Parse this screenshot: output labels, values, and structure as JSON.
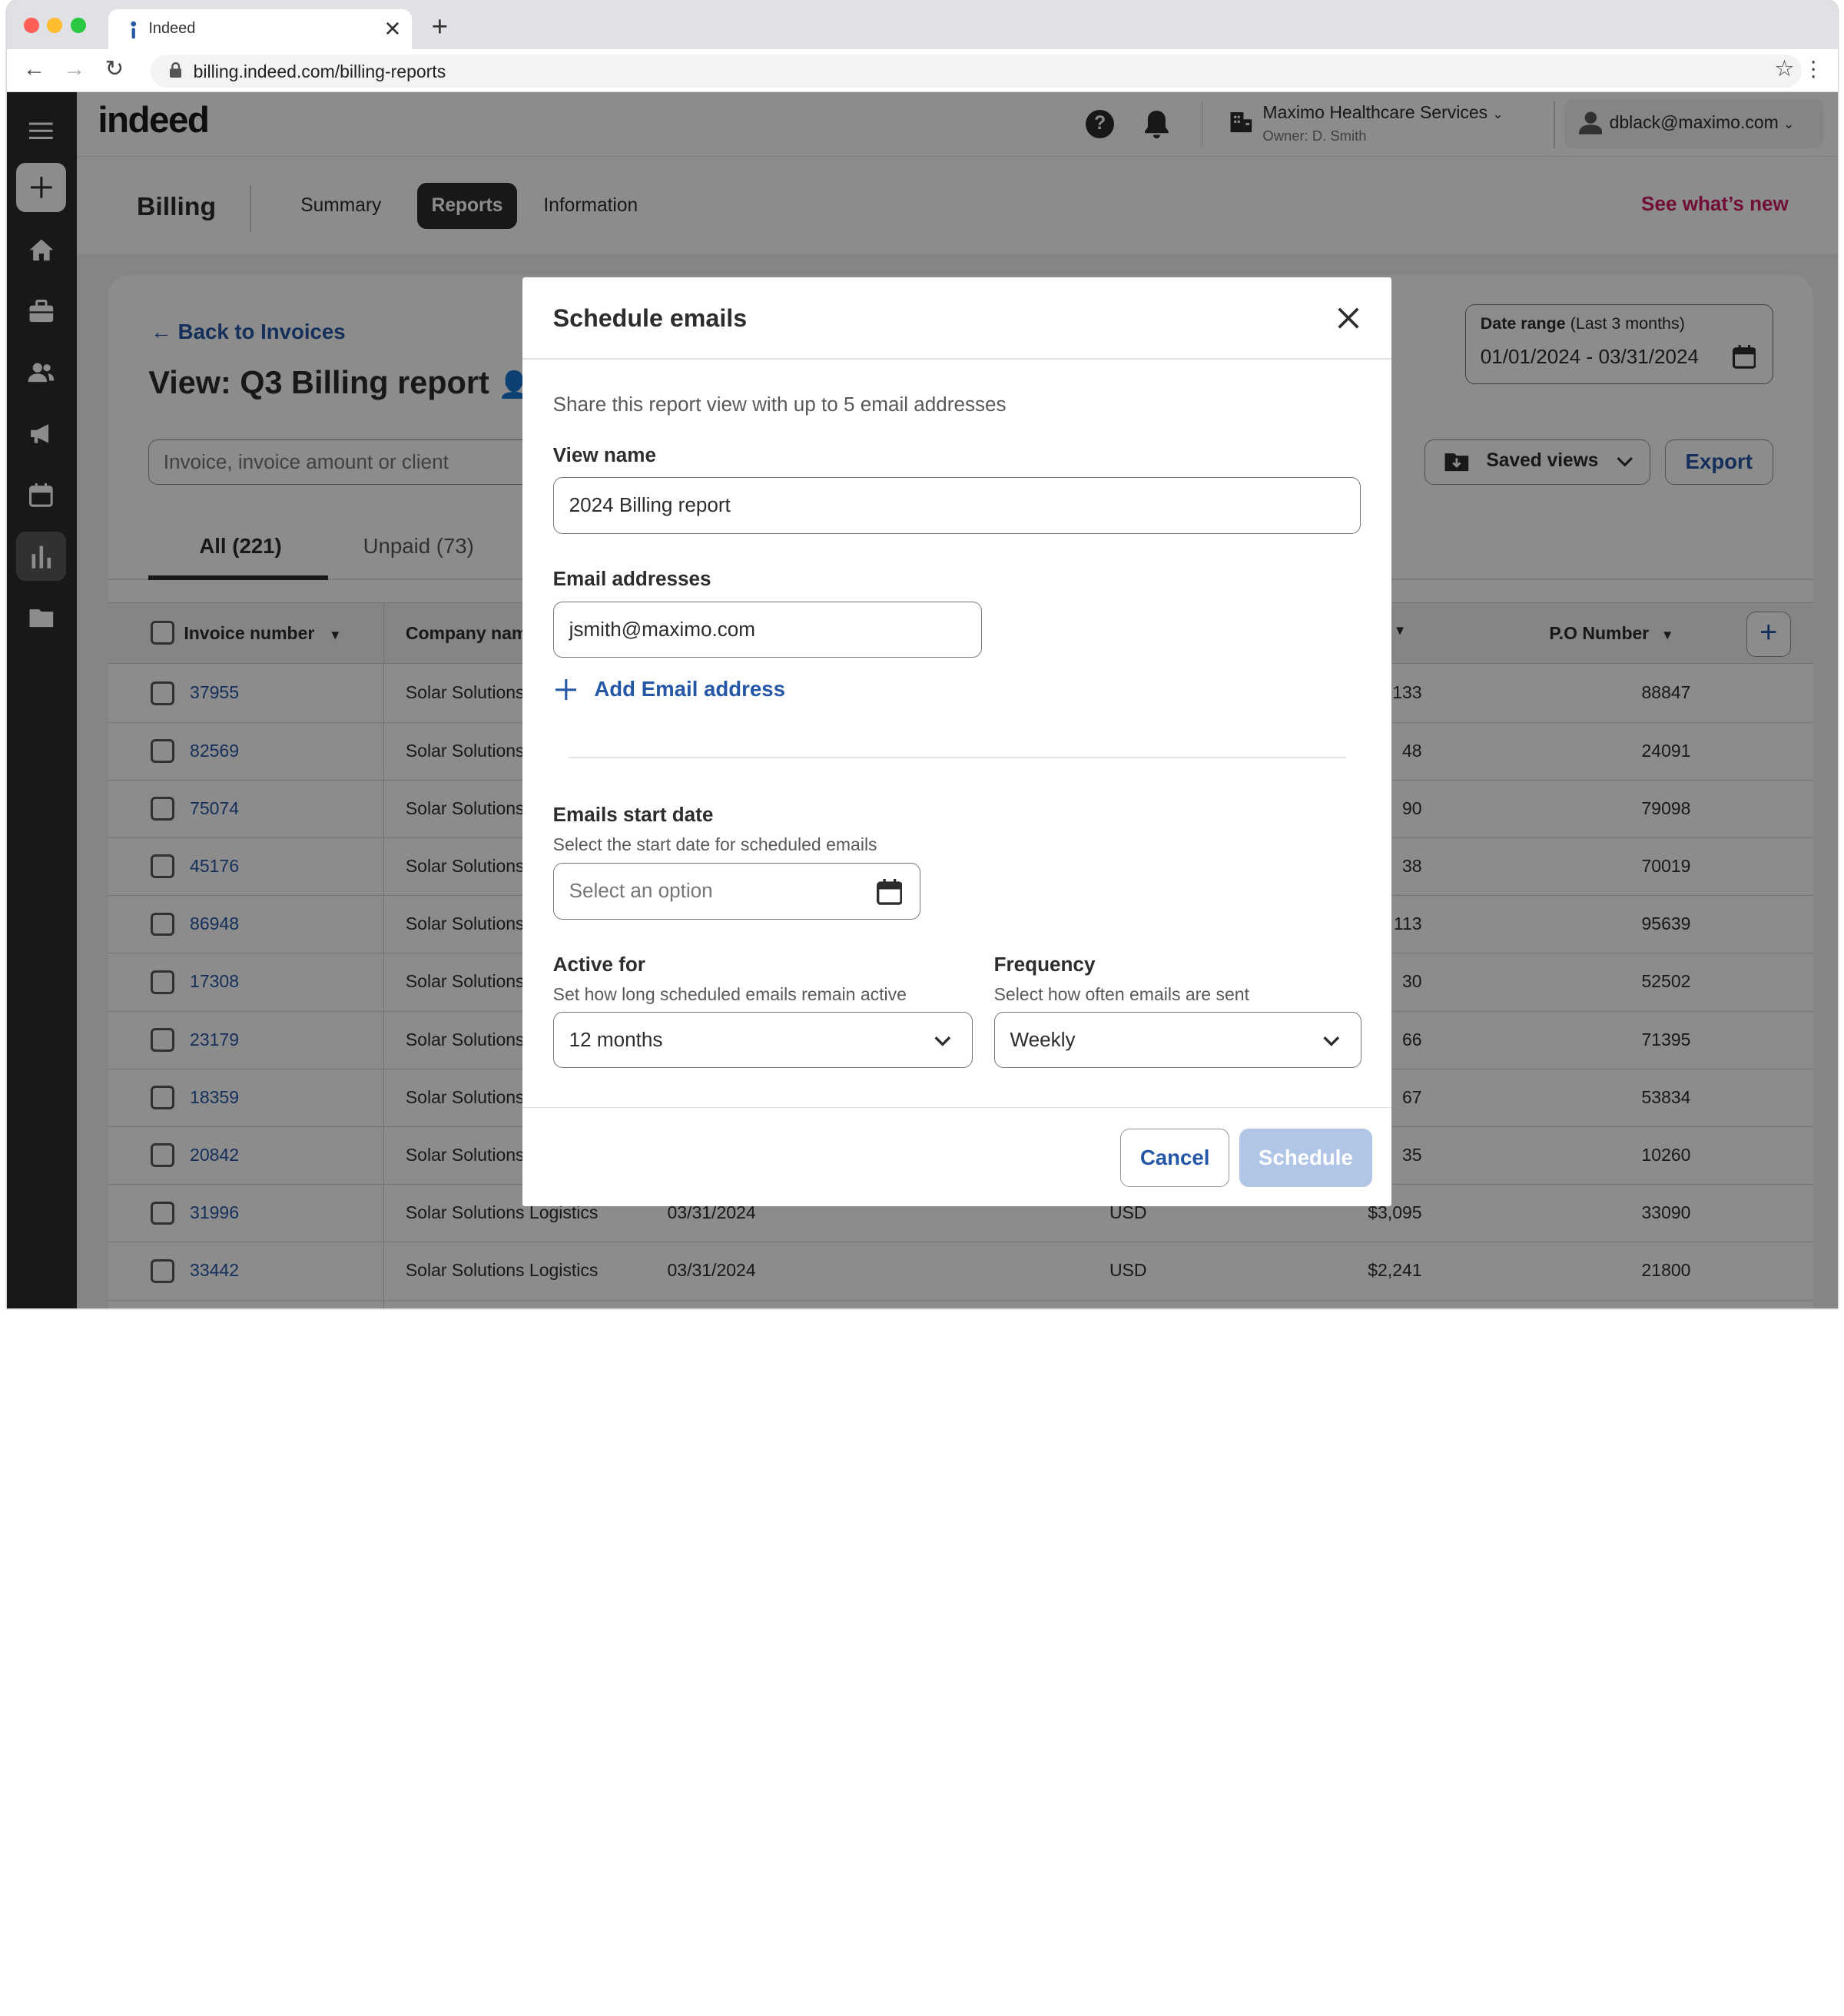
{
  "browser": {
    "tab_title": "Indeed",
    "url": "billing.indeed.com/billing-reports"
  },
  "header": {
    "logo": "indeed",
    "company_name": "Maximo Healthcare Services",
    "company_owner": "Owner: D. Smith",
    "user_email": "dblack@maximo.com"
  },
  "subnav": {
    "title": "Billing",
    "tabs": [
      {
        "label": "Summary"
      },
      {
        "label": "Reports"
      },
      {
        "label": "Information"
      }
    ],
    "active_tab": "Reports",
    "see_whats_new": "See what’s new"
  },
  "report": {
    "back_link": "Back to Invoices",
    "view_title": "View: Q3 Billing report",
    "search_placeholder": "Invoice, invoice amount or client",
    "date_range_label": "Date range",
    "date_range_hint": "(Last 3 months)",
    "date_range_value": "01/01/2024 - 03/31/2024",
    "saved_views": "Saved views",
    "export": "Export",
    "tabs": [
      {
        "label": "All (221)"
      },
      {
        "label": "Unpaid (73)"
      }
    ]
  },
  "table": {
    "columns": [
      "Invoice number",
      "Company nam",
      "P.O Number"
    ],
    "rows": [
      {
        "invoice": "37955",
        "company": "Solar Solutions",
        "date": "",
        "currency": "",
        "amount": "133",
        "po": "88847"
      },
      {
        "invoice": "82569",
        "company": "Solar Solutions",
        "date": "",
        "currency": "",
        "amount": "48",
        "po": "24091"
      },
      {
        "invoice": "75074",
        "company": "Solar Solutions",
        "date": "",
        "currency": "",
        "amount": "90",
        "po": "79098"
      },
      {
        "invoice": "45176",
        "company": "Solar Solutions",
        "date": "",
        "currency": "",
        "amount": "38",
        "po": "70019"
      },
      {
        "invoice": "86948",
        "company": "Solar Solutions",
        "date": "",
        "currency": "",
        "amount": "113",
        "po": "95639"
      },
      {
        "invoice": "17308",
        "company": "Solar Solutions",
        "date": "",
        "currency": "",
        "amount": "30",
        "po": "52502"
      },
      {
        "invoice": "23179",
        "company": "Solar Solutions",
        "date": "",
        "currency": "",
        "amount": "66",
        "po": "71395"
      },
      {
        "invoice": "18359",
        "company": "Solar Solutions",
        "date": "",
        "currency": "",
        "amount": "67",
        "po": "53834"
      },
      {
        "invoice": "20842",
        "company": "Solar Solutions",
        "date": "",
        "currency": "",
        "amount": "35",
        "po": "10260"
      },
      {
        "invoice": "31996",
        "company": "Solar Solutions Logistics",
        "date": "03/31/2024",
        "currency": "USD",
        "amount": "$3,095",
        "po": "33090"
      },
      {
        "invoice": "33442",
        "company": "Solar Solutions Logistics",
        "date": "03/31/2024",
        "currency": "USD",
        "amount": "$2,241",
        "po": "21800"
      }
    ]
  },
  "modal": {
    "title": "Schedule emails",
    "description": "Share this report view with up to 5 email addresses",
    "view_name_label": "View name",
    "view_name_value": "2024 Billing report",
    "email_label": "Email addresses",
    "email_value": "jsmith@maximo.com",
    "add_email": "Add Email address",
    "start_date_label": "Emails start date",
    "start_date_help": "Select the start date for scheduled emails",
    "start_date_placeholder": "Select an option",
    "active_for_label": "Active for",
    "active_for_help": "Set how long scheduled emails remain active",
    "active_for_value": "12 months",
    "frequency_label": "Frequency",
    "frequency_help": "Select how often emails are sent",
    "frequency_value": "Weekly",
    "cancel": "Cancel",
    "schedule": "Schedule"
  },
  "colors": {
    "link_blue": "#2557a7",
    "brand_pink": "#cd1b65",
    "schedule_disabled": "#b1c6e6"
  }
}
